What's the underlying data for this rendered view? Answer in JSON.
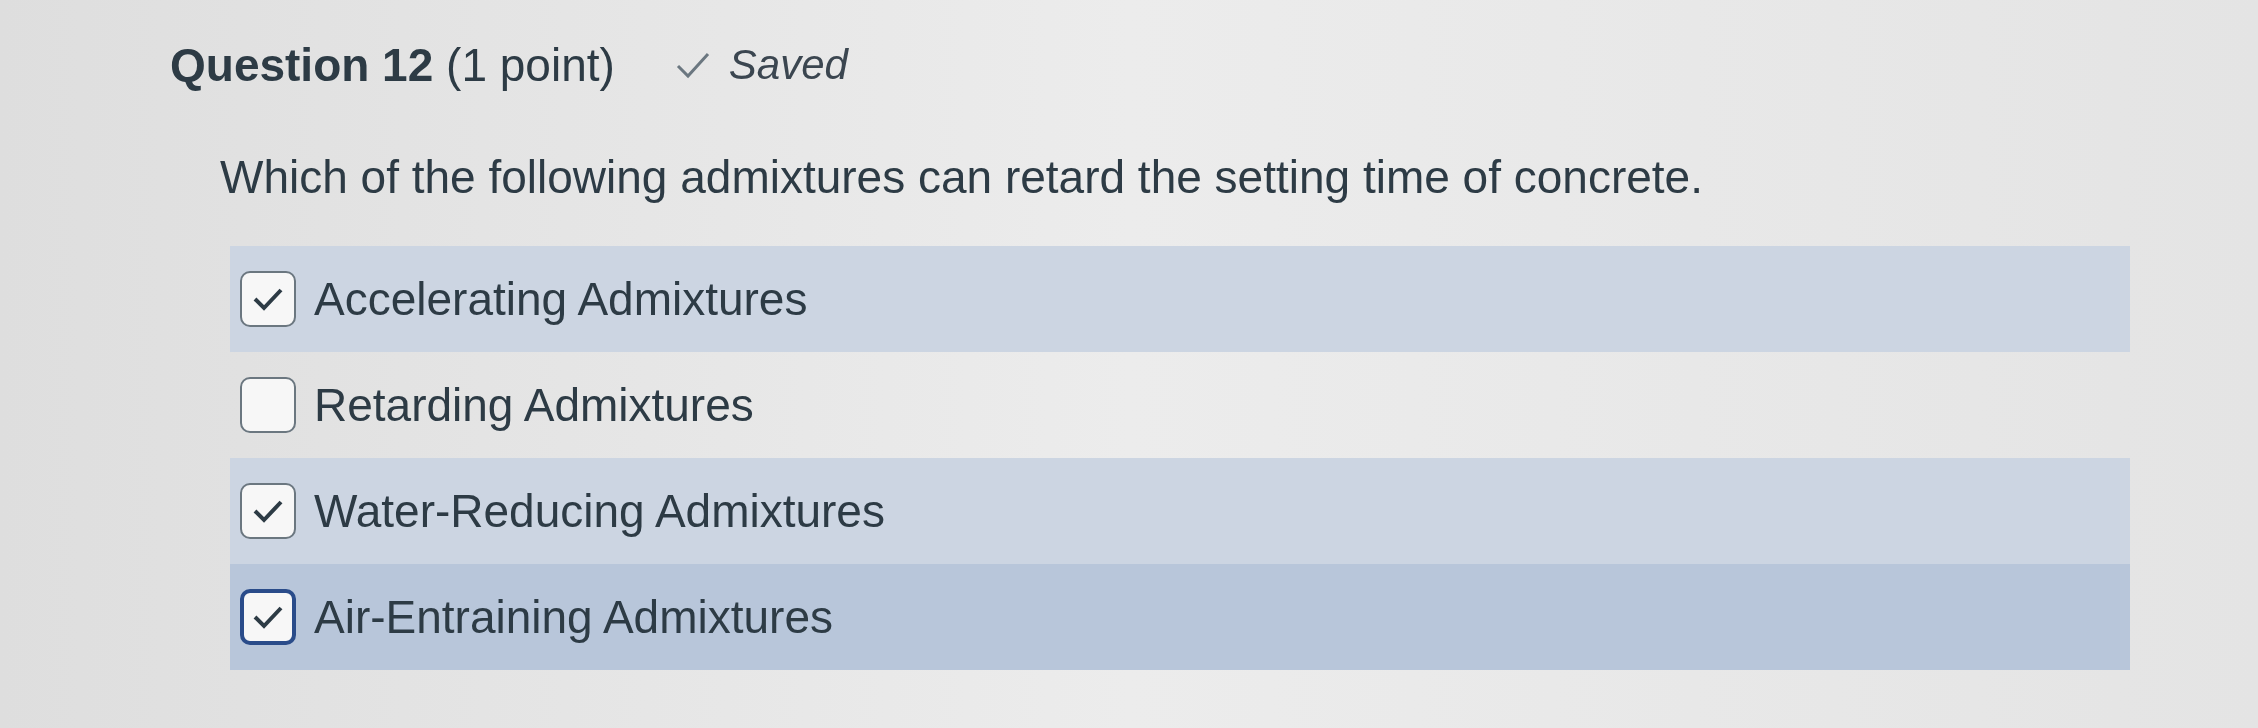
{
  "question": {
    "title": "Question 12",
    "points": "(1 point)",
    "status": "Saved",
    "prompt": "Which of the following admixtures can retard the setting time of concrete."
  },
  "options": [
    {
      "label": "Accelerating Admixtures",
      "checked": true,
      "focused": false
    },
    {
      "label": "Retarding Admixtures",
      "checked": false,
      "focused": false
    },
    {
      "label": "Water-Reducing Admixtures",
      "checked": true,
      "focused": false
    },
    {
      "label": "Air-Entraining Admixtures",
      "checked": true,
      "focused": true
    }
  ]
}
